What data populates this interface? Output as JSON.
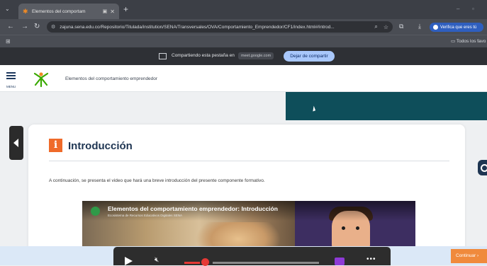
{
  "browser": {
    "tab_title": "Elementos del comportam",
    "url": "zajuna.sena.edu.co/Repositorio/Titulada/institution/SENA/Transversales/OVA/Comportamiento_Emprendedor/CF1/index.html#/introd...",
    "verify_label": "Verifica que eres tú",
    "bookmarks_folder": "Todos los favo"
  },
  "share_bar": {
    "text": "Compartiendo esta pestaña en",
    "host": "meet.google.com",
    "stop_label": "Dejar de compartir"
  },
  "app": {
    "menu_label": "MENU",
    "course_title": "Elementos del comportamiento emprendedor"
  },
  "content": {
    "heading_icon_text": "i",
    "heading": "Introducción",
    "intro_text": "A continuación, se presenta el video que hará una breve introducción del presente componente formativo."
  },
  "video": {
    "title": "Elementos del comportamiento emprendedor: Introducción",
    "subtitle": "Ecosistema de Recursos Educativos Digitales SENA"
  },
  "footer": {
    "continue_label": "Continuar ›"
  },
  "colors": {
    "accent_orange": "#ef6a2a",
    "sena_green": "#39a900",
    "banner_teal": "#0e4e5a",
    "heading_navy": "#1e3552"
  },
  "player": {
    "volume_fraction": 0.4,
    "progress_fraction": 0.0
  }
}
